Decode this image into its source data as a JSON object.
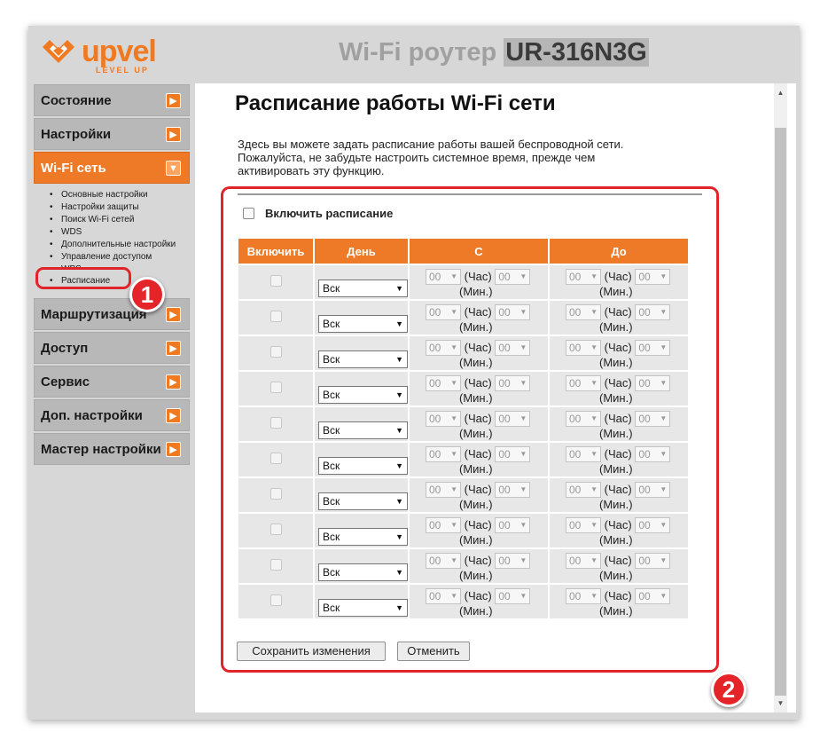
{
  "header": {
    "logo_text": "upvel",
    "logo_tagline": "LEVEL UP",
    "title_prefix": "Wi-Fi роутер",
    "model": "UR-316N3G"
  },
  "sidebar": {
    "items": [
      {
        "label": "Состояние"
      },
      {
        "label": "Настройки"
      },
      {
        "label": "Wi-Fi сеть"
      },
      {
        "label": "Маршрутизация"
      },
      {
        "label": "Доступ"
      },
      {
        "label": "Сервис"
      },
      {
        "label": "Доп. настройки"
      },
      {
        "label": "Мастер настройки"
      }
    ],
    "wifi_submenu": [
      "Основные настройки",
      "Настройки защиты",
      "Поиск Wi-Fi сетей",
      "WDS",
      "Дополнительные настройки",
      "Управление доступом",
      "WPS",
      "Расписание"
    ]
  },
  "annotations": {
    "badge_1": "1",
    "badge_2": "2"
  },
  "page": {
    "title": "Расписание работы Wi-Fi сети",
    "description": [
      "Здесь вы можете задать расписание работы вашей беспроводной сети.",
      "Пожалуйста, не забудьте настроить системное время, прежде чем",
      "активировать эту функцию."
    ],
    "enable_label": "Включить расписание"
  },
  "table": {
    "headers": [
      "Включить",
      "День",
      "С",
      "До"
    ],
    "rows": [
      {
        "day": "Вск",
        "from_hour": "00",
        "from_min": "00",
        "to_hour": "00",
        "to_min": "00"
      },
      {
        "day": "Вск",
        "from_hour": "00",
        "from_min": "00",
        "to_hour": "00",
        "to_min": "00"
      },
      {
        "day": "Вск",
        "from_hour": "00",
        "from_min": "00",
        "to_hour": "00",
        "to_min": "00"
      },
      {
        "day": "Вск",
        "from_hour": "00",
        "from_min": "00",
        "to_hour": "00",
        "to_min": "00"
      },
      {
        "day": "Вск",
        "from_hour": "00",
        "from_min": "00",
        "to_hour": "00",
        "to_min": "00"
      },
      {
        "day": "Вск",
        "from_hour": "00",
        "from_min": "00",
        "to_hour": "00",
        "to_min": "00"
      },
      {
        "day": "Вск",
        "from_hour": "00",
        "from_min": "00",
        "to_hour": "00",
        "to_min": "00"
      },
      {
        "day": "Вск",
        "from_hour": "00",
        "from_min": "00",
        "to_hour": "00",
        "to_min": "00"
      },
      {
        "day": "Вск",
        "from_hour": "00",
        "from_min": "00",
        "to_hour": "00",
        "to_min": "00"
      },
      {
        "day": "Вск",
        "from_hour": "00",
        "from_min": "00",
        "to_hour": "00",
        "to_min": "00"
      }
    ],
    "hour_unit": "(Час)",
    "min_unit": "(Мин.)"
  },
  "buttons": {
    "save": "Сохранить изменения",
    "cancel": "Отменить"
  },
  "colors": {
    "accent": "#ee7a28",
    "annotation_red": "#e0242a",
    "sidebar_bg": "#b8b8b8"
  }
}
